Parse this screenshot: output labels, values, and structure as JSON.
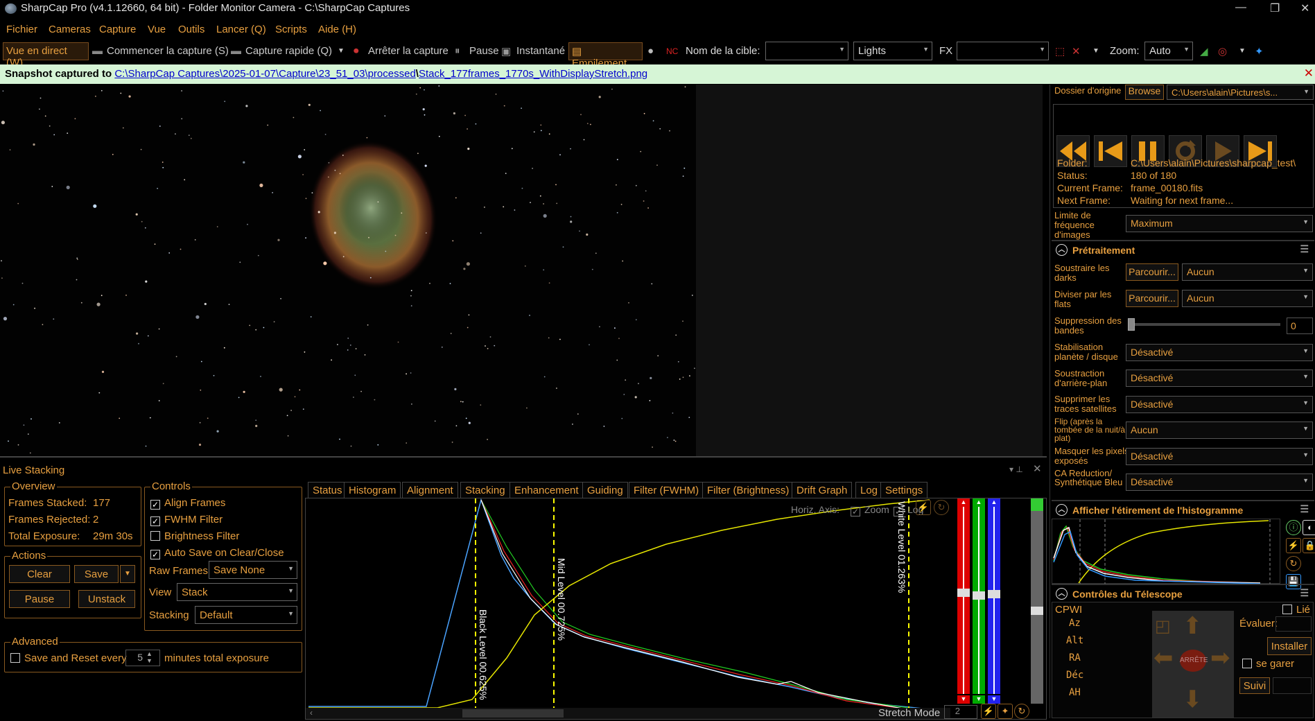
{
  "window": {
    "title": "SharpCap Pro (v4.1.12660, 64 bit) - Folder Monitor Camera - C:\\SharpCap Captures"
  },
  "menu": {
    "items": [
      "Fichier",
      "Cameras",
      "Capture",
      "Vue",
      "Outils",
      "Lancer (Q)",
      "Scripts",
      "Aide (H)"
    ]
  },
  "toolbar": {
    "live_view": "Vue en direct (W)",
    "start_capture": "Commencer la capture (S)",
    "quick_capture": "Capture rapide (Q)",
    "stop_capture": "Arrêter la capture",
    "pause": "Pause",
    "snapshot": "Instantané",
    "stacking": "Empilement",
    "target_label": "Nom de la cible:",
    "target_value": "",
    "frame_type": "Lights",
    "fx_label": "FX",
    "fx_value": "",
    "zoom_label": "Zoom:",
    "zoom_value": "Auto"
  },
  "notice": {
    "prefix": "Snapshot captured to ",
    "path": "C:\\SharpCap Captures\\2025-01-07\\Capture\\23_51_03\\processed",
    "sep": "\\",
    "file": "Stack_177frames_1770s_WithDisplayStretch.png"
  },
  "camera_panel": {
    "source_folder_label": "Dossier d'origine",
    "browse": "Browse",
    "source_folder": "C:\\Users\\alain\\Pictures\\s...",
    "info": [
      {
        "k": "Folder:",
        "v": "C:\\Users\\alain\\Pictures\\sharpcap_test\\"
      },
      {
        "k": "Status:",
        "v": "180 of 180"
      },
      {
        "k": "Current Frame:",
        "v": "frame_00180.fits"
      },
      {
        "k": "Next Frame:",
        "v": "Waiting for next frame..."
      }
    ],
    "frame_rate_label": "Limite de fréquence d'images",
    "frame_rate_value": "Maximum"
  },
  "preprocessing": {
    "title": "Prétraitement",
    "darks_label": "Soustraire les darks",
    "darks_btn": "Parcourir...",
    "darks_value": "Aucun",
    "flats_label": "Diviser par les flats",
    "flats_btn": "Parcourir...",
    "flats_value": "Aucun",
    "banding_label": "Suppression des bandes",
    "banding_value": "0",
    "rows": [
      {
        "label": "Stabilisation planète / disque",
        "value": "Désactivé"
      },
      {
        "label": "Soustraction d'arrière-plan",
        "value": "Désactivé"
      },
      {
        "label": "Supprimer les traces satellites",
        "value": "Désactivé"
      },
      {
        "label": "Flip (après la tombée de la nuit/à plat)",
        "value": "Aucun"
      },
      {
        "label": "Masquer les pixels exposés",
        "value": "Désactivé"
      },
      {
        "label": "CA Reduction/ Synthétique Bleu",
        "value": "Désactivé"
      }
    ]
  },
  "stretch_panel": {
    "title": "Afficher l'étirement de l'histogramme"
  },
  "telescope": {
    "title": "Contrôles du Télescope",
    "mount": "CPWI",
    "linked": "Lié",
    "coords": [
      "Az",
      "Alt",
      "RA",
      "Déc",
      "AH"
    ],
    "rate_label": "Évaluer:",
    "install": "Installer",
    "keep": "se garer",
    "stop": "ARRÊTE",
    "follow": "Suivi"
  },
  "live_stacking": {
    "title": "Live Stacking",
    "overview": {
      "title": "Overview",
      "rows": [
        {
          "k": "Frames Stacked:",
          "v": "177"
        },
        {
          "k": "Frames Rejected:",
          "v": "2"
        },
        {
          "k": "Total Exposure:",
          "v": "29m 30s"
        }
      ]
    },
    "controls": {
      "title": "Controls",
      "checks": [
        {
          "label": "Align Frames",
          "on": true
        },
        {
          "label": "FWHM Filter",
          "on": true
        },
        {
          "label": "Brightness Filter",
          "on": false
        },
        {
          "label": "Auto Save on Clear/Close",
          "on": true
        }
      ],
      "raw_frames_label": "Raw Frames",
      "raw_frames": "Save None",
      "view_label": "View",
      "view": "Stack",
      "stacking_label": "Stacking",
      "stacking": "Default"
    },
    "actions": {
      "title": "Actions",
      "clear": "Clear",
      "save": "Save",
      "pause": "Pause",
      "unstack": "Unstack"
    },
    "advanced": {
      "title": "Advanced",
      "save_reset": "Save and Reset every",
      "minutes": "5",
      "suffix": "minutes total exposure"
    },
    "tabs": [
      "Status",
      "Histogram",
      "Alignment",
      "Stacking",
      "Enhancement",
      "Guiding",
      "Filter (FWHM)",
      "Filter (Brightness)",
      "Drift Graph",
      "Log",
      "Settings"
    ],
    "active_tab": "Histogram",
    "histogram": {
      "horiz_axis": "Horiz. Axis:",
      "zoom": "Zoom",
      "log": "Log",
      "black_level": "Black Level 00.625%",
      "mid_level": "Mid Level 00.725%",
      "white_level": "White Level 01.263%",
      "stretch_mode": "Stretch Mode",
      "stretch_value": "2"
    }
  },
  "colors": {
    "accent": "#e8a040",
    "notice_bg": "#d6f5d6",
    "link": "#0000cc"
  }
}
